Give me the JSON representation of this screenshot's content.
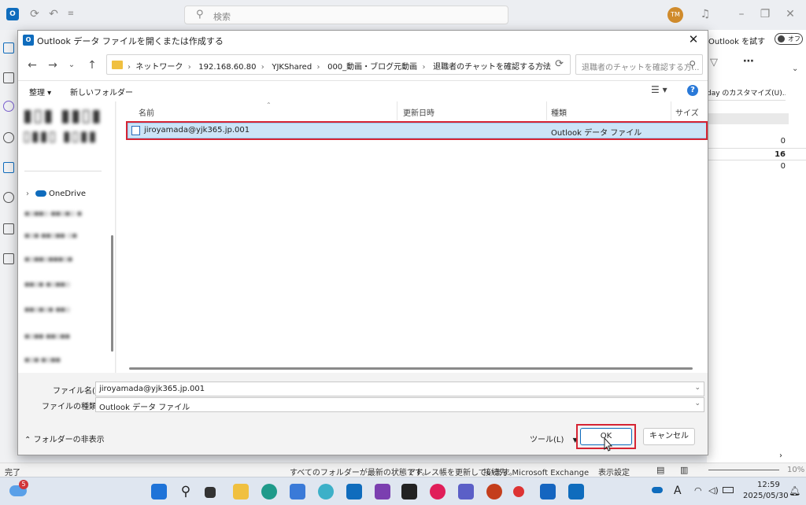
{
  "outlook": {
    "search_placeholder": "検索",
    "avatar_initials": "TM",
    "try_new_label": "Outlook を試す",
    "toggle_label": "オフ",
    "pane_customize": "day のカスタマイズ(U)...",
    "counts": [
      "0",
      "16",
      "0"
    ],
    "status_left": "完了",
    "status_sync": "すべてのフォルダーが最新の状態です。",
    "status_addr": "アドレス帳を更新しています。",
    "status_conn": "接続先: Microsoft Exchange",
    "status_view": "表示設定",
    "zoom": "10%"
  },
  "dialog": {
    "title": "Outlook データ ファイルを開くまたは作成する",
    "breadcrumbs": [
      "ネットワーク",
      "192.168.60.80",
      "YJKShared",
      "000_動画・ブログ元動画",
      "退職者のチャットを確認する方法"
    ],
    "search_placeholder": "退職者のチャットを確認する方...",
    "organize_label": "整理 ▾",
    "new_folder_label": "新しいフォルダー",
    "nav_onedrive": "OneDrive",
    "columns": {
      "name": "名前",
      "date": "更新日時",
      "type": "種類",
      "size": "サイズ"
    },
    "file": {
      "name": "jiroyamada@yjk365.jp.001",
      "type": "Outlook データ ファイル"
    },
    "filename_label": "ファイル名(N):",
    "filename_value": "jiroyamada@yjk365.jp.001",
    "filetype_label": "ファイルの種類(T):",
    "filetype_value": "Outlook データ ファイル",
    "hide_folders": "フォルダーの非表示",
    "tools_label": "ツール(L)",
    "ok_label": "OK",
    "cancel_label": "キャンセル"
  },
  "taskbar": {
    "notification_badge": "5",
    "time": "12:59",
    "date": "2025/05/30",
    "ime": "A"
  },
  "colors": {
    "accent": "#0f6cbd",
    "highlight": "#d62433",
    "selection": "#cce4f7"
  }
}
